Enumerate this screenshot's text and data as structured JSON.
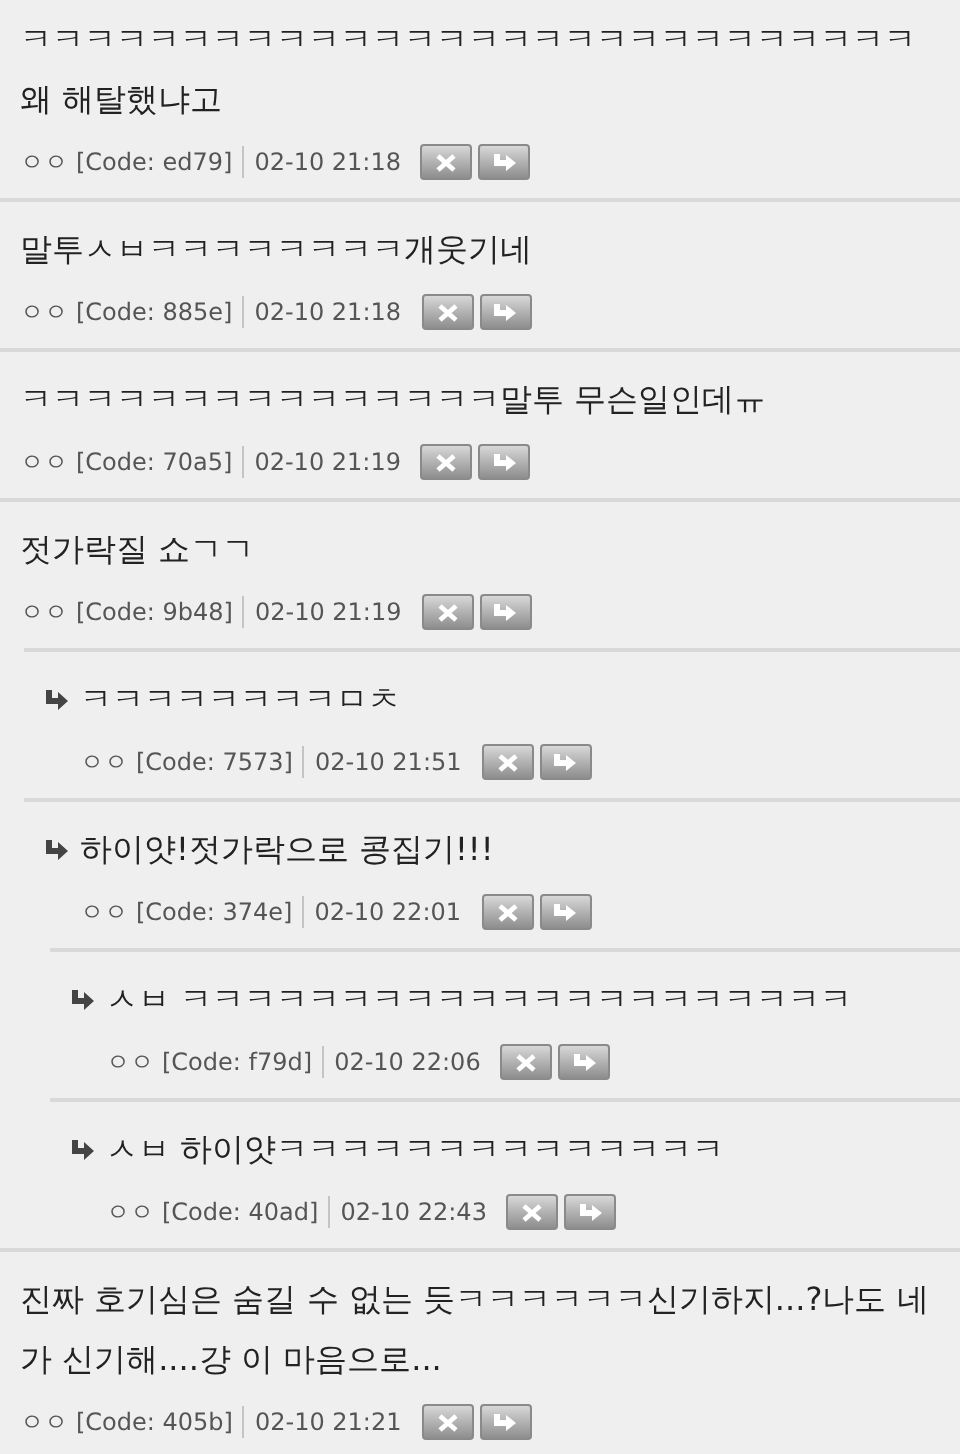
{
  "comments": [
    {
      "text": "ㅋㅋㅋㅋㅋㅋㅋㅋㅋㅋㅋㅋㅋㅋㅋㅋㅋㅋㅋㅋㅋㅋㅋㅋㅋㅋㅋㅋ 왜 해탈했냐고",
      "author": "ㅇㅇ",
      "code": "[Code: ed79]",
      "time": "02-10 21:18"
    },
    {
      "text": "말투ㅅㅂㅋㅋㅋㅋㅋㅋㅋㅋ개웃기네",
      "author": "ㅇㅇ",
      "code": "[Code: 885e]",
      "time": "02-10 21:18"
    },
    {
      "text": "ㅋㅋㅋㅋㅋㅋㅋㅋㅋㅋㅋㅋㅋㅋㅋ말투 무슨일인데ㅠ",
      "author": "ㅇㅇ",
      "code": "[Code: 70a5]",
      "time": "02-10 21:19"
    },
    {
      "text": "젓가락질 쇼ㄱㄱ",
      "author": "ㅇㅇ",
      "code": "[Code: 9b48]",
      "time": "02-10 21:19",
      "children": [
        {
          "text": "ㅋㅋㅋㅋㅋㅋㅋㅋㅁㅊ",
          "author": "ㅇㅇ",
          "code": "[Code: 7573]",
          "time": "02-10 21:51"
        },
        {
          "text": "하이얏!젓가락으로 콩집기!!!",
          "author": "ㅇㅇ",
          "code": "[Code: 374e]",
          "time": "02-10 22:01",
          "children": [
            {
              "text": "ㅅㅂ ㅋㅋㅋㅋㅋㅋㅋㅋㅋㅋㅋㅋㅋㅋㅋㅋㅋㅋㅋㅋㅋ",
              "author": "ㅇㅇ",
              "code": "[Code: f79d]",
              "time": "02-10 22:06"
            },
            {
              "text": "ㅅㅂ 하이얏ㅋㅋㅋㅋㅋㅋㅋㅋㅋㅋㅋㅋㅋㅋ",
              "author": "ㅇㅇ",
              "code": "[Code: 40ad]",
              "time": "02-10 22:43"
            }
          ]
        }
      ]
    },
    {
      "text": "진짜 호기심은 숨길 수 없는 듯ㅋㅋㅋㅋㅋㅋ신기하지...?나도 네가 신기해....걍 이 마음으로...",
      "author": "ㅇㅇ",
      "code": "[Code: 405b]",
      "time": "02-10 21:21"
    }
  ]
}
